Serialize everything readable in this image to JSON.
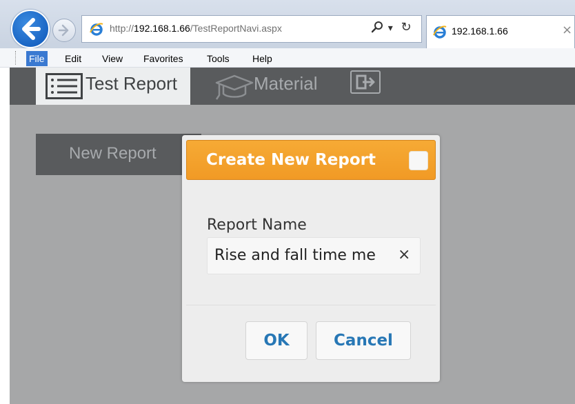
{
  "browser": {
    "url_prefix": "http://",
    "url_host": "192.168.1.66",
    "url_path": "/TestReportNavi.aspx",
    "search_icon": "magnifier-icon",
    "dropdown_glyph": "▾",
    "refresh_glyph": "↻",
    "tab_title": "192.168.1.66",
    "tab_close": "×"
  },
  "menubar": {
    "items": [
      "File",
      "Edit",
      "View",
      "Favorites",
      "Tools",
      "Help"
    ],
    "active_index": 0
  },
  "appnav": {
    "tabs": [
      {
        "label": "Test Report",
        "icon": "list-icon",
        "active": true
      },
      {
        "label": "Material",
        "icon": "graduation-cap-icon",
        "active": false
      }
    ],
    "exit_icon": "logout-icon"
  },
  "page": {
    "new_report_label": "New Report"
  },
  "modal": {
    "title": "Create New Report",
    "field_label": "Report Name",
    "field_value": "Rise and fall time me",
    "clear_glyph": "×",
    "ok_label": "OK",
    "cancel_label": "Cancel"
  },
  "colors": {
    "header_orange": "#f19a25",
    "nav_dark": "#595b5d",
    "page_gray": "#a6a7a8",
    "button_text_blue": "#2777b5"
  }
}
